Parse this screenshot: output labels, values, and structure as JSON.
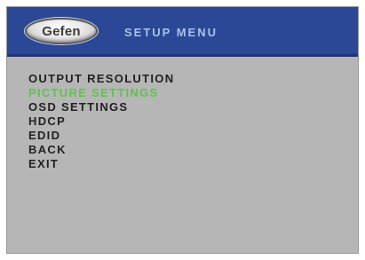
{
  "header": {
    "logo_text": "Gefen",
    "title": "SETUP MENU"
  },
  "menu": {
    "items": [
      {
        "label": "OUTPUT RESOLUTION",
        "selected": false
      },
      {
        "label": "PICTURE SETTINGS",
        "selected": true
      },
      {
        "label": "OSD SETTINGS",
        "selected": false
      },
      {
        "label": "HDCP",
        "selected": false
      },
      {
        "label": "EDID",
        "selected": false
      },
      {
        "label": "BACK",
        "selected": false
      },
      {
        "label": "EXIT",
        "selected": false
      }
    ]
  },
  "colors": {
    "header_bg": "#2a4896",
    "menu_bg": "#b6b6b6",
    "selected_text": "#5fc24e",
    "menu_text": "#222222",
    "title_text": "#a9c1e6"
  }
}
